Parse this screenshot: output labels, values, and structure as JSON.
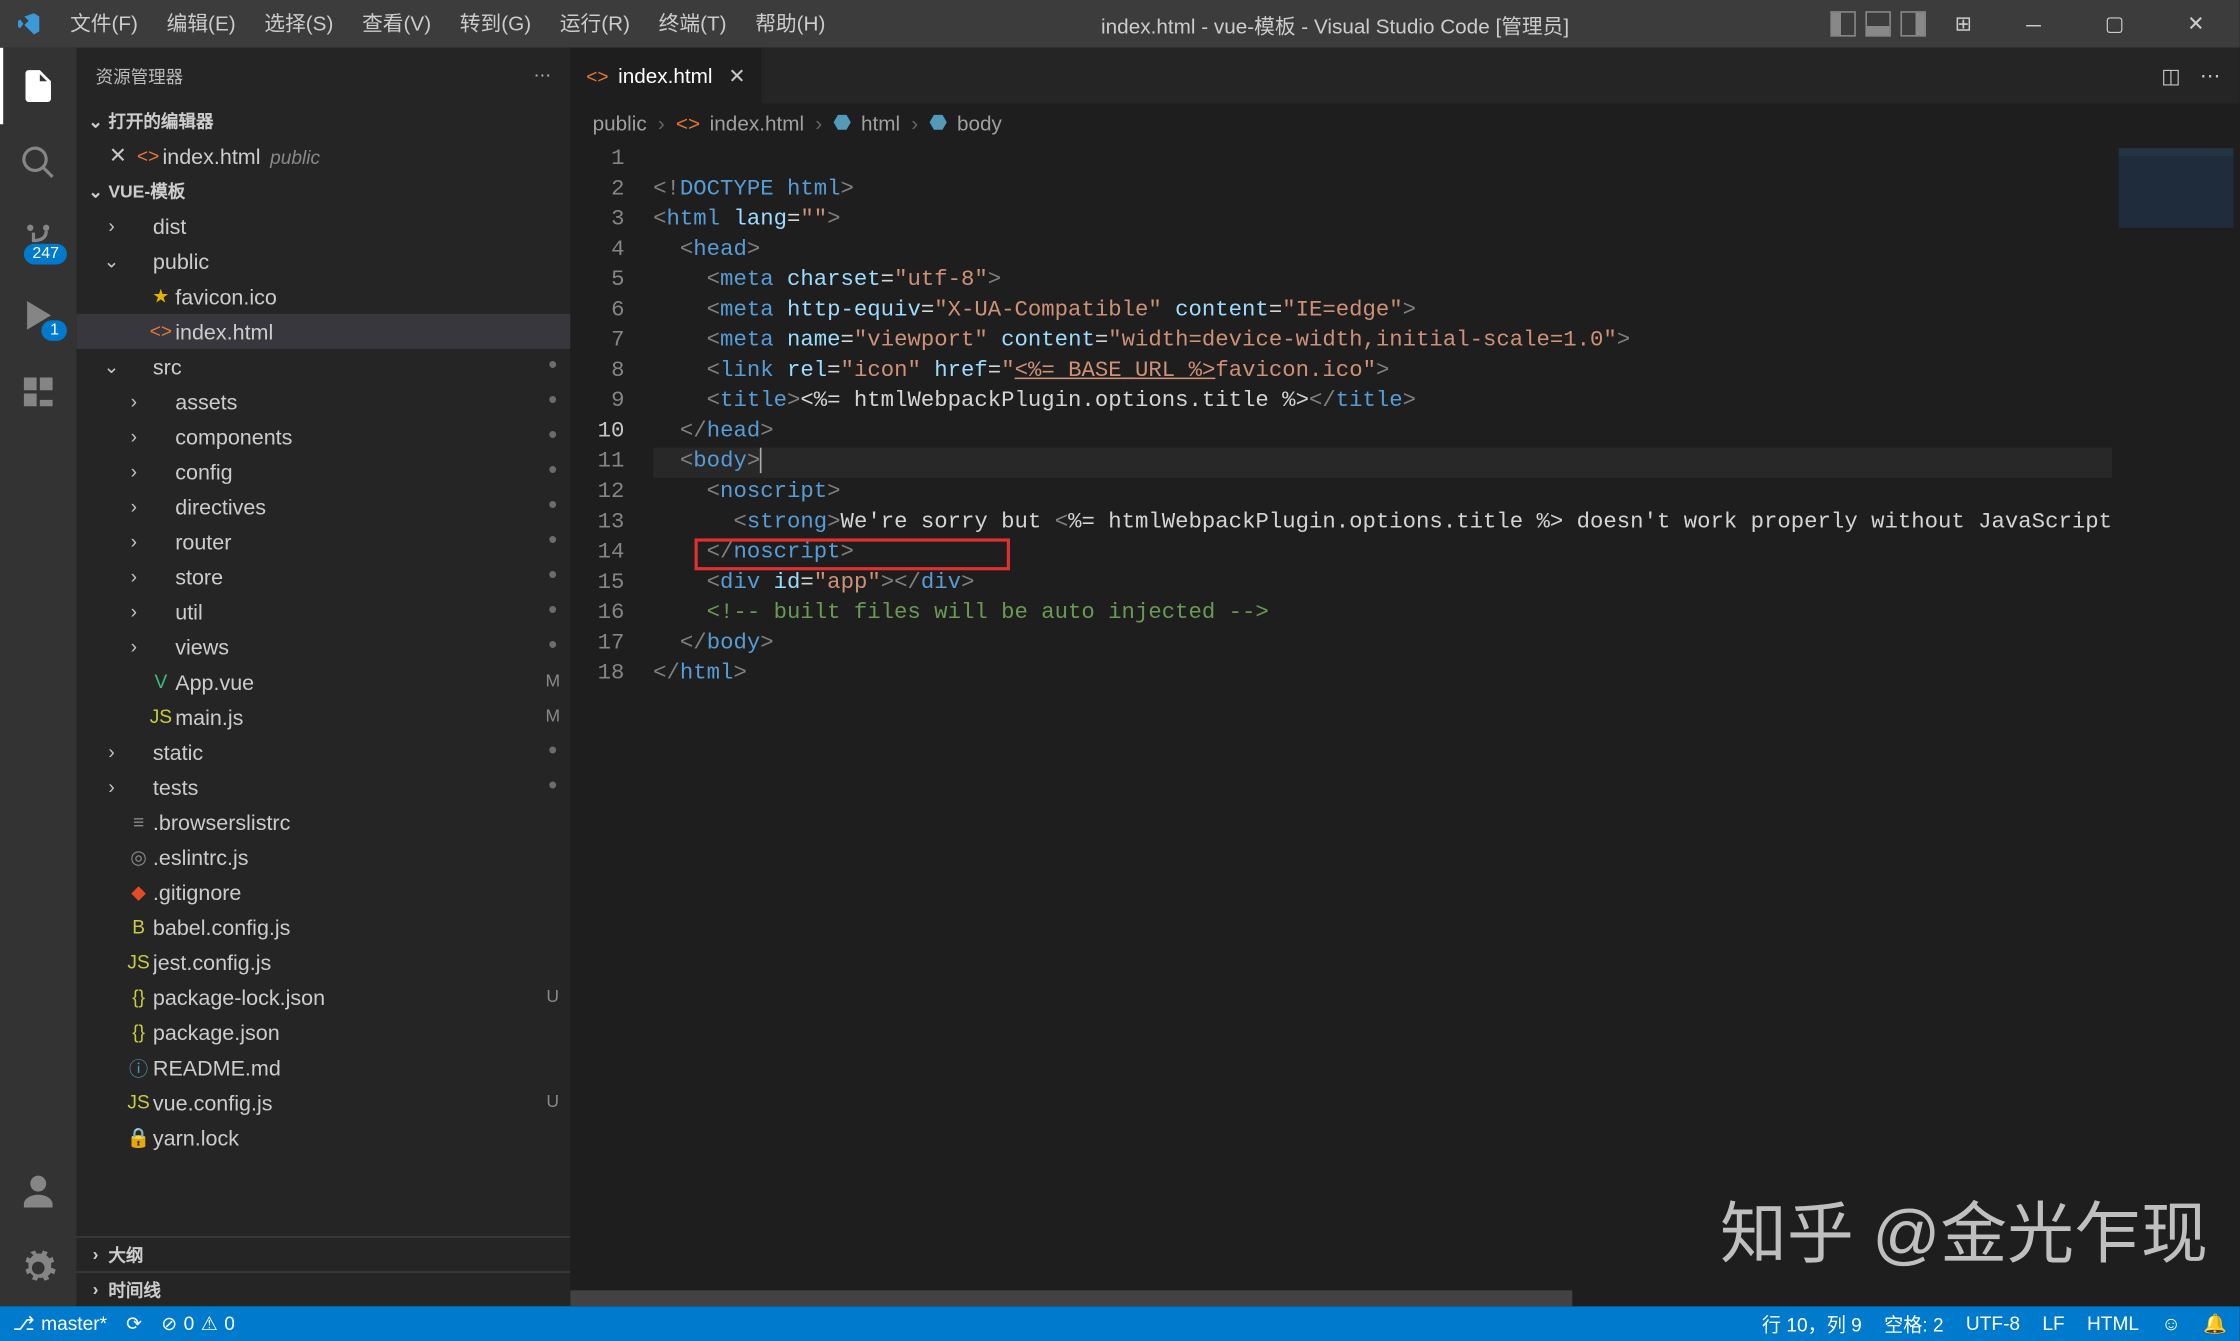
{
  "titlebar": {
    "menus": [
      "文件(F)",
      "编辑(E)",
      "选择(S)",
      "查看(V)",
      "转到(G)",
      "运行(R)",
      "终端(T)",
      "帮助(H)"
    ],
    "title": "index.html - vue-模板 - Visual Studio Code [管理员]"
  },
  "activitybar": {
    "scm_badge": "247",
    "debug_badge": "1"
  },
  "sidebar": {
    "title": "资源管理器",
    "open_editors_label": "打开的编辑器",
    "open_editor_file": "index.html",
    "open_editor_folder": "public",
    "project_name": "VUE-模板",
    "tree": [
      {
        "depth": 1,
        "chev": "›",
        "icon": "",
        "label": "dist",
        "decor": ""
      },
      {
        "depth": 1,
        "chev": "⌄",
        "icon": "",
        "label": "public",
        "decor": ""
      },
      {
        "depth": 2,
        "chev": "",
        "icon": "★",
        "iconClass": "fi-star",
        "label": "favicon.ico",
        "decor": ""
      },
      {
        "depth": 2,
        "chev": "",
        "icon": "<>",
        "iconClass": "fi-html",
        "label": "index.html",
        "decor": "",
        "selected": true
      },
      {
        "depth": 1,
        "chev": "⌄",
        "icon": "",
        "label": "src",
        "decor": "•"
      },
      {
        "depth": 2,
        "chev": "›",
        "icon": "",
        "label": "assets",
        "decor": "•"
      },
      {
        "depth": 2,
        "chev": "›",
        "icon": "",
        "label": "components",
        "decor": "•"
      },
      {
        "depth": 2,
        "chev": "›",
        "icon": "",
        "label": "config",
        "decor": "•"
      },
      {
        "depth": 2,
        "chev": "›",
        "icon": "",
        "label": "directives",
        "decor": "•"
      },
      {
        "depth": 2,
        "chev": "›",
        "icon": "",
        "label": "router",
        "decor": "•"
      },
      {
        "depth": 2,
        "chev": "›",
        "icon": "",
        "label": "store",
        "decor": "•"
      },
      {
        "depth": 2,
        "chev": "›",
        "icon": "",
        "label": "util",
        "decor": "•"
      },
      {
        "depth": 2,
        "chev": "›",
        "icon": "",
        "label": "views",
        "decor": "•"
      },
      {
        "depth": 2,
        "chev": "",
        "icon": "V",
        "iconClass": "fi-vue",
        "label": "App.vue",
        "decor": "M"
      },
      {
        "depth": 2,
        "chev": "",
        "icon": "JS",
        "iconClass": "fi-js",
        "label": "main.js",
        "decor": "M"
      },
      {
        "depth": 1,
        "chev": "›",
        "icon": "",
        "label": "static",
        "decor": "•"
      },
      {
        "depth": 1,
        "chev": "›",
        "icon": "",
        "label": "tests",
        "decor": "•"
      },
      {
        "depth": 1,
        "chev": "",
        "icon": "≡",
        "iconClass": "fi-gear",
        "label": ".browserslistrc",
        "decor": ""
      },
      {
        "depth": 1,
        "chev": "",
        "icon": "◎",
        "iconClass": "fi-gear",
        "label": ".eslintrc.js",
        "decor": ""
      },
      {
        "depth": 1,
        "chev": "",
        "icon": "◆",
        "iconClass": "fi-git",
        "label": ".gitignore",
        "decor": ""
      },
      {
        "depth": 1,
        "chev": "",
        "icon": "B",
        "iconClass": "fi-babel",
        "label": "babel.config.js",
        "decor": ""
      },
      {
        "depth": 1,
        "chev": "",
        "icon": "JS",
        "iconClass": "fi-js",
        "label": "jest.config.js",
        "decor": ""
      },
      {
        "depth": 1,
        "chev": "",
        "icon": "{}",
        "iconClass": "fi-json",
        "label": "package-lock.json",
        "decor": "U"
      },
      {
        "depth": 1,
        "chev": "",
        "icon": "{}",
        "iconClass": "fi-json",
        "label": "package.json",
        "decor": ""
      },
      {
        "depth": 1,
        "chev": "",
        "icon": "ⓘ",
        "iconClass": "fi-md",
        "label": "README.md",
        "decor": ""
      },
      {
        "depth": 1,
        "chev": "",
        "icon": "JS",
        "iconClass": "fi-js",
        "label": "vue.config.js",
        "decor": "U"
      },
      {
        "depth": 1,
        "chev": "",
        "icon": "🔒",
        "iconClass": "fi-lock",
        "label": "yarn.lock",
        "decor": ""
      }
    ],
    "outline_label": "大纲",
    "timeline_label": "时间线"
  },
  "editor": {
    "tab_label": "index.html",
    "breadcrumbs": [
      "public",
      "index.html",
      "html",
      "body"
    ],
    "line_count": 18,
    "active_line": 10
  },
  "statusbar": {
    "branch": "master*",
    "sync": "",
    "errors": "0",
    "warnings": "0",
    "cursor": "行 10，列 9",
    "spaces": "空格: 2",
    "encoding": "UTF-8",
    "eol": "LF",
    "lang": "HTML"
  },
  "watermark": "知乎 @金光乍现"
}
